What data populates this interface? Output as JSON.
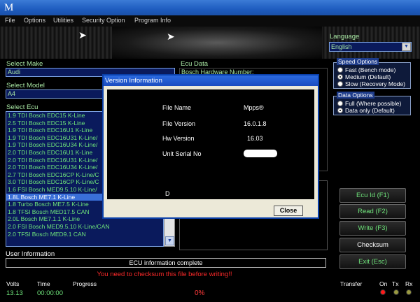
{
  "window": {
    "title_glyph": "M"
  },
  "menu": [
    "File",
    "Options",
    "Utilities",
    "Security Option",
    "Program Info"
  ],
  "language": {
    "label": "Language",
    "value": "English"
  },
  "make": {
    "label": "Select Make",
    "value": "Audi"
  },
  "model": {
    "label": "Select Model",
    "value": "A4"
  },
  "ecu": {
    "label": "Select Ecu",
    "items": [
      "1.9 TDI Bosch EDC15 K-Line",
      "2.5 TDI Bosch EDC15 K-Line",
      "1.9 TDI Bosch EDC16U1 K-Line",
      "1.9 TDI Bosch EDC16U31 K-Line/",
      "1.9 TDI Bosch EDC16U34 K-Line/",
      "2.0 TDI Bosch EDC16U1 K-Line",
      "2.0 TDI Bosch EDC16U31 K-Line/",
      "2.0 TDI Bosch EDC16U34 K-Line/",
      "2.7 TDI Bosch EDC16CP K-Line/C",
      "3.0 TDI Bosch EDC16CP K-Line/C",
      "1.6 FSI Bosch MED9.5.10 K-Line/",
      "1.8L Bosch ME7.1 K-Line",
      "1.8 Turbo Bosch ME7.5 K-Line",
      "1.8 TFSI Bosch MED17.5 CAN",
      "2.0L Bosch ME7.1.1 K-Line",
      "2.0 FSI Bosch MED9.5.10 K-Line/CAN",
      "2.0 TFSI Bosch MED9.1 CAN"
    ],
    "selected_index": 11
  },
  "ecu_data": {
    "label": "Ecu Data",
    "first_line": "Bosch Hardware Number:"
  },
  "speed_options": {
    "title": "Speed Options",
    "items": [
      "Fast (Bench mode)",
      "Medium (Default)",
      "Slow (Recovery Mode)"
    ],
    "selected_index": 1
  },
  "data_options": {
    "title": "Data Options",
    "items": [
      "Full (Where possible)",
      "Data only (Default)"
    ],
    "selected_index": 1
  },
  "buttons": {
    "ecu_id": "Ecu Id   (F1)",
    "read": "Read   (F2)",
    "write": "Write   (F3)",
    "checksum": "Checksum",
    "exit": "Exit   (Esc)"
  },
  "user_info": {
    "label": "User Information",
    "message": "ECU information complete"
  },
  "warning": "You need to checksum this file before writing!!",
  "status": {
    "volts_label": "Volts",
    "volts": "13.13",
    "time_label": "Time",
    "time": "00:00:00",
    "progress_label": "Progress",
    "progress": "0%",
    "transfer_label": "Transfer",
    "on_label": "On",
    "tx_label": "Tx",
    "rx_label": "Rx",
    "led_colors": [
      "#ff1a1a",
      "#9a9a40",
      "#9a9a40"
    ]
  },
  "dialog": {
    "title": "Version Information",
    "file_name_label": "File Name",
    "file_name": "Mpps®",
    "file_version_label": "File Version",
    "file_version": "16.0.1.8",
    "hw_version_label": "Hw Version",
    "hw_version": "16.03",
    "serial_label": "Unit Serial No",
    "partial": "D",
    "close": "Close"
  }
}
